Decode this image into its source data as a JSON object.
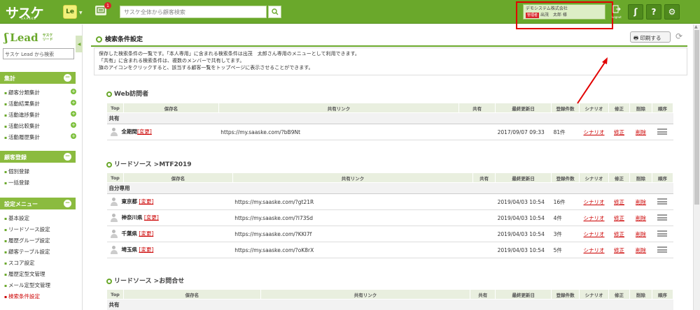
{
  "header": {
    "logo_text": "サスケ",
    "logo_sub": "SAASKE",
    "le_badge": "Le",
    "notif_count": "1",
    "search_placeholder": "サスケ全体から顧客検索",
    "company": "デモシステム株式会社",
    "role_badge": "管理者",
    "user_name": "出茂　太郎 様",
    "logout_label": "Logout",
    "help_label": "?",
    "brand_color": "#6aa82b"
  },
  "sidebar": {
    "lead_logo": "Lead",
    "lead_tiny_1": "サスケ",
    "lead_tiny_2": "リード",
    "search_placeholder": "サスケ Lead から検索",
    "sections": [
      {
        "title": "集計",
        "items": [
          "顧客分類集計",
          "活動結果集計",
          "活動進捗集計",
          "活動比較集計",
          "活動履歴集計"
        ]
      },
      {
        "title": "顧客登録",
        "items": [
          "個別登録",
          "一括登録"
        ]
      },
      {
        "title": "設定メニュー",
        "items": [
          "基本設定",
          "リードソース設定",
          "履歴グループ設定",
          "顧客テーブル設定",
          "スコア設定",
          "履歴定型文管理",
          "メール定型文管理",
          "検索条件設定"
        ]
      }
    ]
  },
  "main": {
    "title": "検索条件設定",
    "print_label": "印刷する",
    "desc_lines": [
      "保存した検索条件の一覧です。「本人専用」に含まれる検索条件は出茂　太郎さん専用のメニューとして利用できます。",
      "「共有」に含まれる検索条件は、複数のメンバーで共有してます。",
      "旗のアイコンをクリックすると、該当する顧客一覧をトップページに表示させることができます。"
    ],
    "columns": [
      "Top",
      "保存名",
      "共有リンク",
      "共有",
      "最終更新日",
      "登録件数",
      "シナリオ",
      "修正",
      "削除",
      "順序"
    ],
    "change_label": "[変更]",
    "scenario_label": "シナリオ",
    "edit_label": "修正",
    "delete_label": "削除",
    "sections": [
      {
        "title": "Web訪問者",
        "group": "共有",
        "rows": [
          {
            "name": "全期間",
            "link": "https://my.saaske.com/?bB9Nt",
            "shared": "",
            "updated": "2017/09/07 09:33",
            "count": "81件"
          }
        ]
      },
      {
        "title": "リードソース >MTF2019",
        "group": "自分専用",
        "rows": [
          {
            "name": "東京都",
            "link": "https://my.saaske.com/?gt21R",
            "shared": "",
            "updated": "2019/04/03 10:54",
            "count": "16件"
          },
          {
            "name": "神奈川県",
            "link": "https://my.saaske.com/?I73Sd",
            "shared": "",
            "updated": "2019/04/03 10:54",
            "count": "4件"
          },
          {
            "name": "千葉県",
            "link": "https://my.saaske.com/?KKI7f",
            "shared": "",
            "updated": "2019/04/03 10:54",
            "count": "3件"
          },
          {
            "name": "埼玉県",
            "link": "https://my.saaske.com/?oK8rX",
            "shared": "",
            "updated": "2019/04/03 10:54",
            "count": "5件"
          }
        ]
      },
      {
        "title": "リードソース >お問合せ",
        "group": "共有",
        "rows": []
      }
    ]
  }
}
